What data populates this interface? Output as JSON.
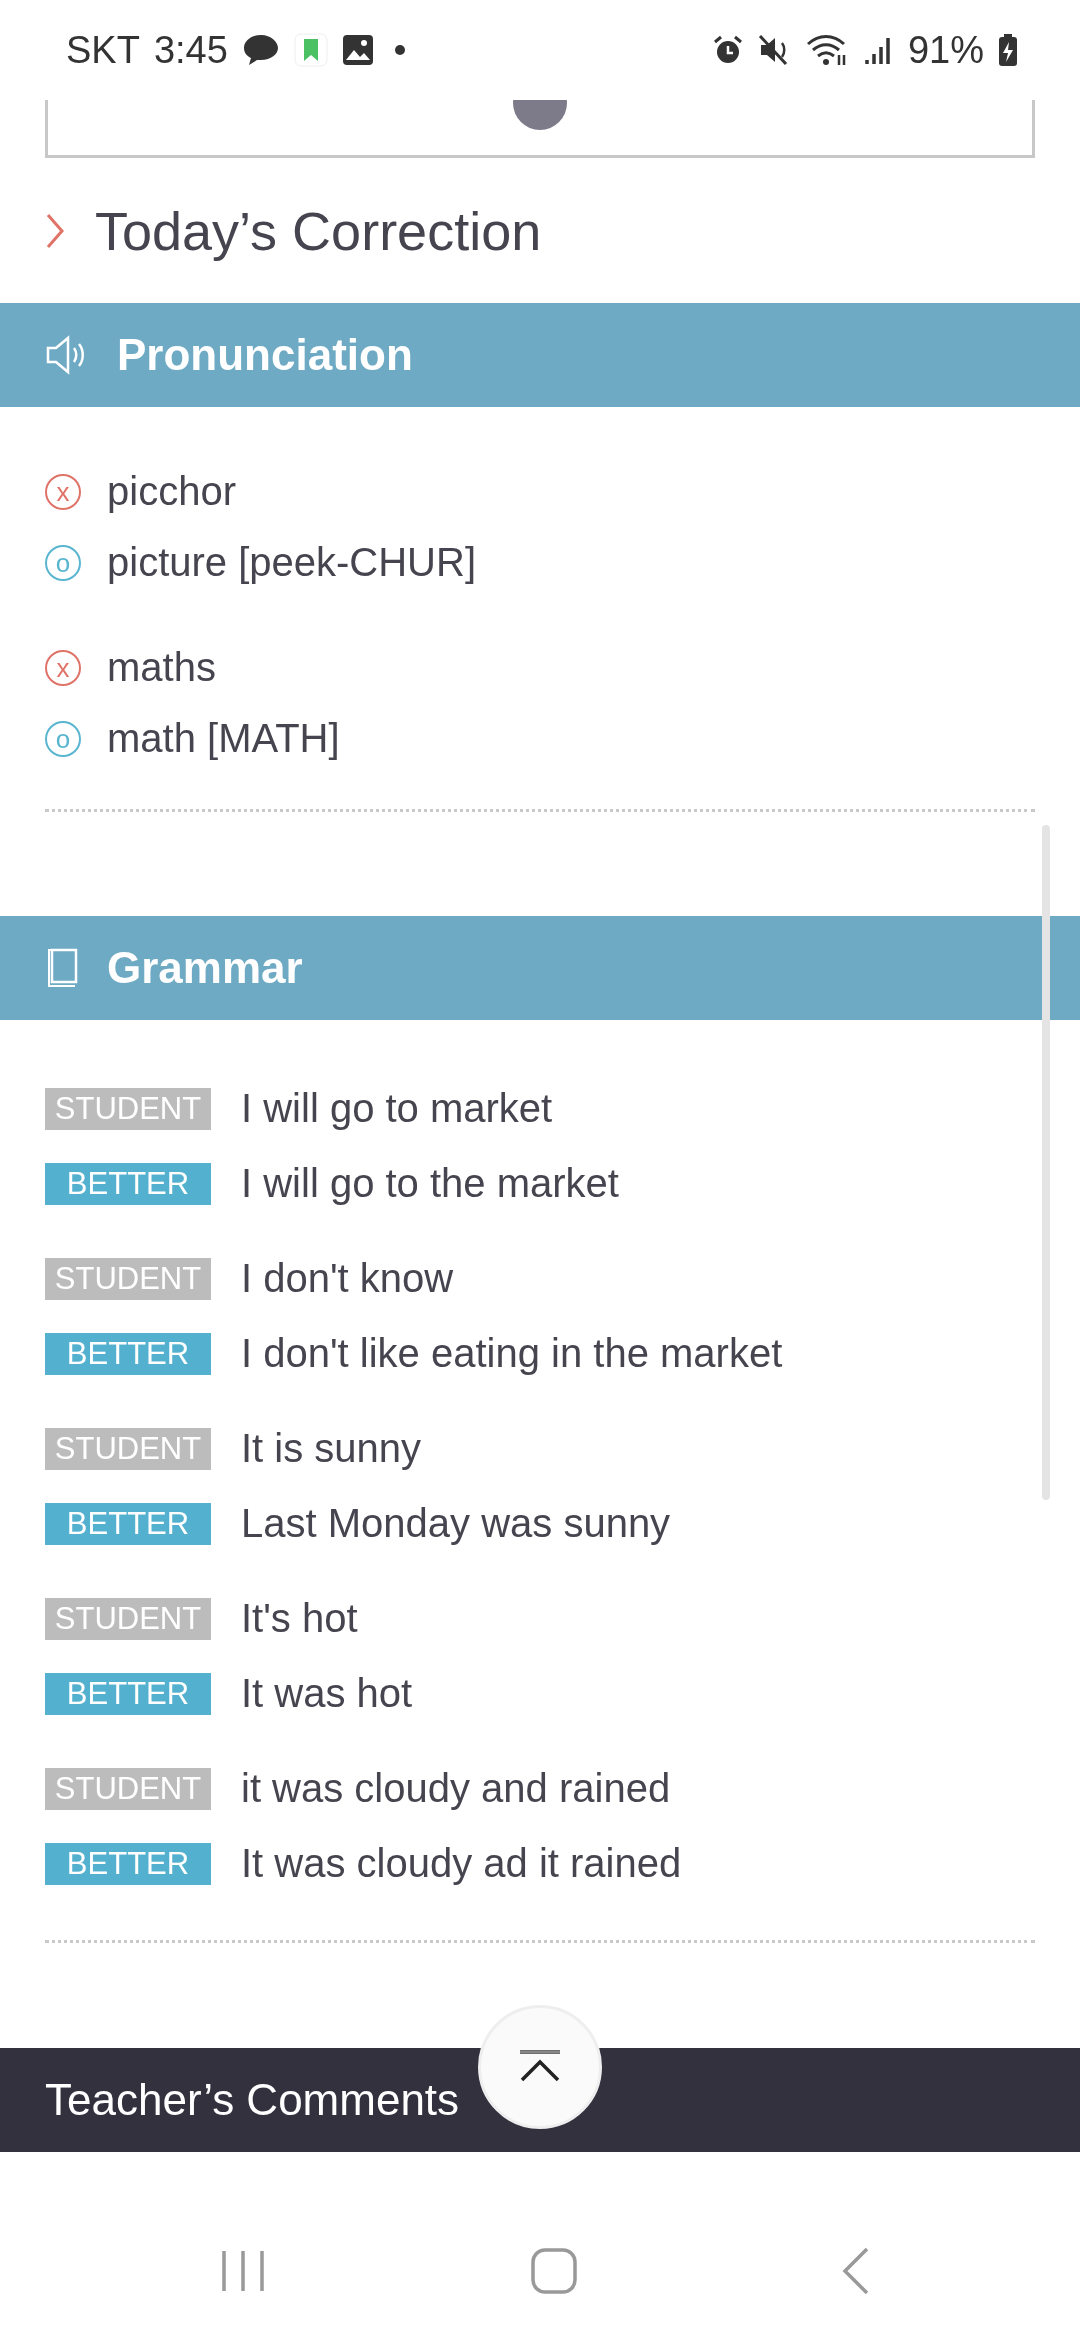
{
  "status_bar": {
    "carrier": "SKT",
    "time": "3:45",
    "battery": "91%"
  },
  "heading": "Today’s Correction",
  "pronunciation": {
    "title": "Pronunciation",
    "groups": [
      [
        {
          "kind": "wrong",
          "mark": "x",
          "text": "picchor"
        },
        {
          "kind": "correct",
          "mark": "o",
          "text": "picture [peek-CHUR]"
        }
      ],
      [
        {
          "kind": "wrong",
          "mark": "x",
          "text": "maths"
        },
        {
          "kind": "correct",
          "mark": "o",
          "text": "math [MATH]"
        }
      ]
    ]
  },
  "grammar": {
    "title": "Grammar",
    "pairs": [
      [
        {
          "kind": "student",
          "label": "STUDENT",
          "text": "I will go to market"
        },
        {
          "kind": "better",
          "label": "BETTER",
          "text": "I will go to the market"
        }
      ],
      [
        {
          "kind": "student",
          "label": "STUDENT",
          "text": "I don't know"
        },
        {
          "kind": "better",
          "label": "BETTER",
          "text": "I don't like eating in the market"
        }
      ],
      [
        {
          "kind": "student",
          "label": "STUDENT",
          "text": "It is sunny"
        },
        {
          "kind": "better",
          "label": "BETTER",
          "text": "Last Monday was sunny"
        }
      ],
      [
        {
          "kind": "student",
          "label": "STUDENT",
          "text": "It's hot"
        },
        {
          "kind": "better",
          "label": "BETTER",
          "text": "It was hot"
        }
      ],
      [
        {
          "kind": "student",
          "label": "STUDENT",
          "text": "it was cloudy and rained"
        },
        {
          "kind": "better",
          "label": "BETTER",
          "text": "It was cloudy ad it rained"
        }
      ]
    ]
  },
  "comments": {
    "title": "Teacher’s Comments"
  }
}
